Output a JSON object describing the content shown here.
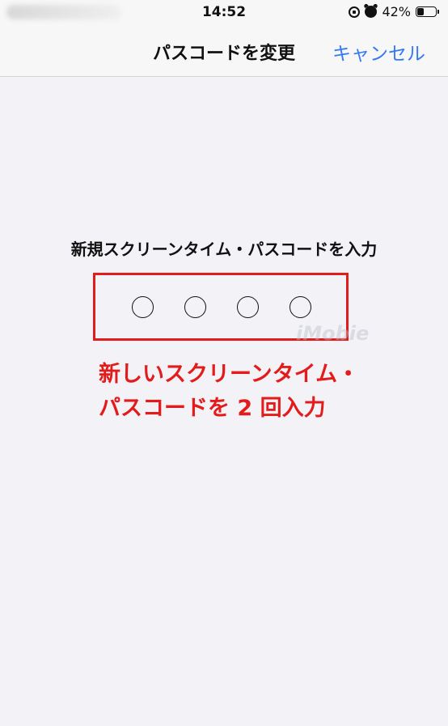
{
  "status_bar": {
    "time": "14:52",
    "battery_percent_label": "42%",
    "battery_level": 0.42,
    "icons": [
      "orientation-lock-icon",
      "alarm-icon",
      "battery-icon"
    ]
  },
  "nav": {
    "title": "パスコードを変更",
    "cancel_label": "キャンセル"
  },
  "passcode": {
    "prompt": "新規スクリーンタイム・パスコードを入力",
    "digit_count": 4
  },
  "annotation": {
    "line1": "新しいスクリーンタイム・",
    "line2": "パスコードを 2 回入力",
    "color": "#e31b1b"
  },
  "watermark": "iMobie",
  "colors": {
    "accent": "#3478f6",
    "annotation_red": "#e31b1b",
    "background": "#f2f2f7"
  }
}
